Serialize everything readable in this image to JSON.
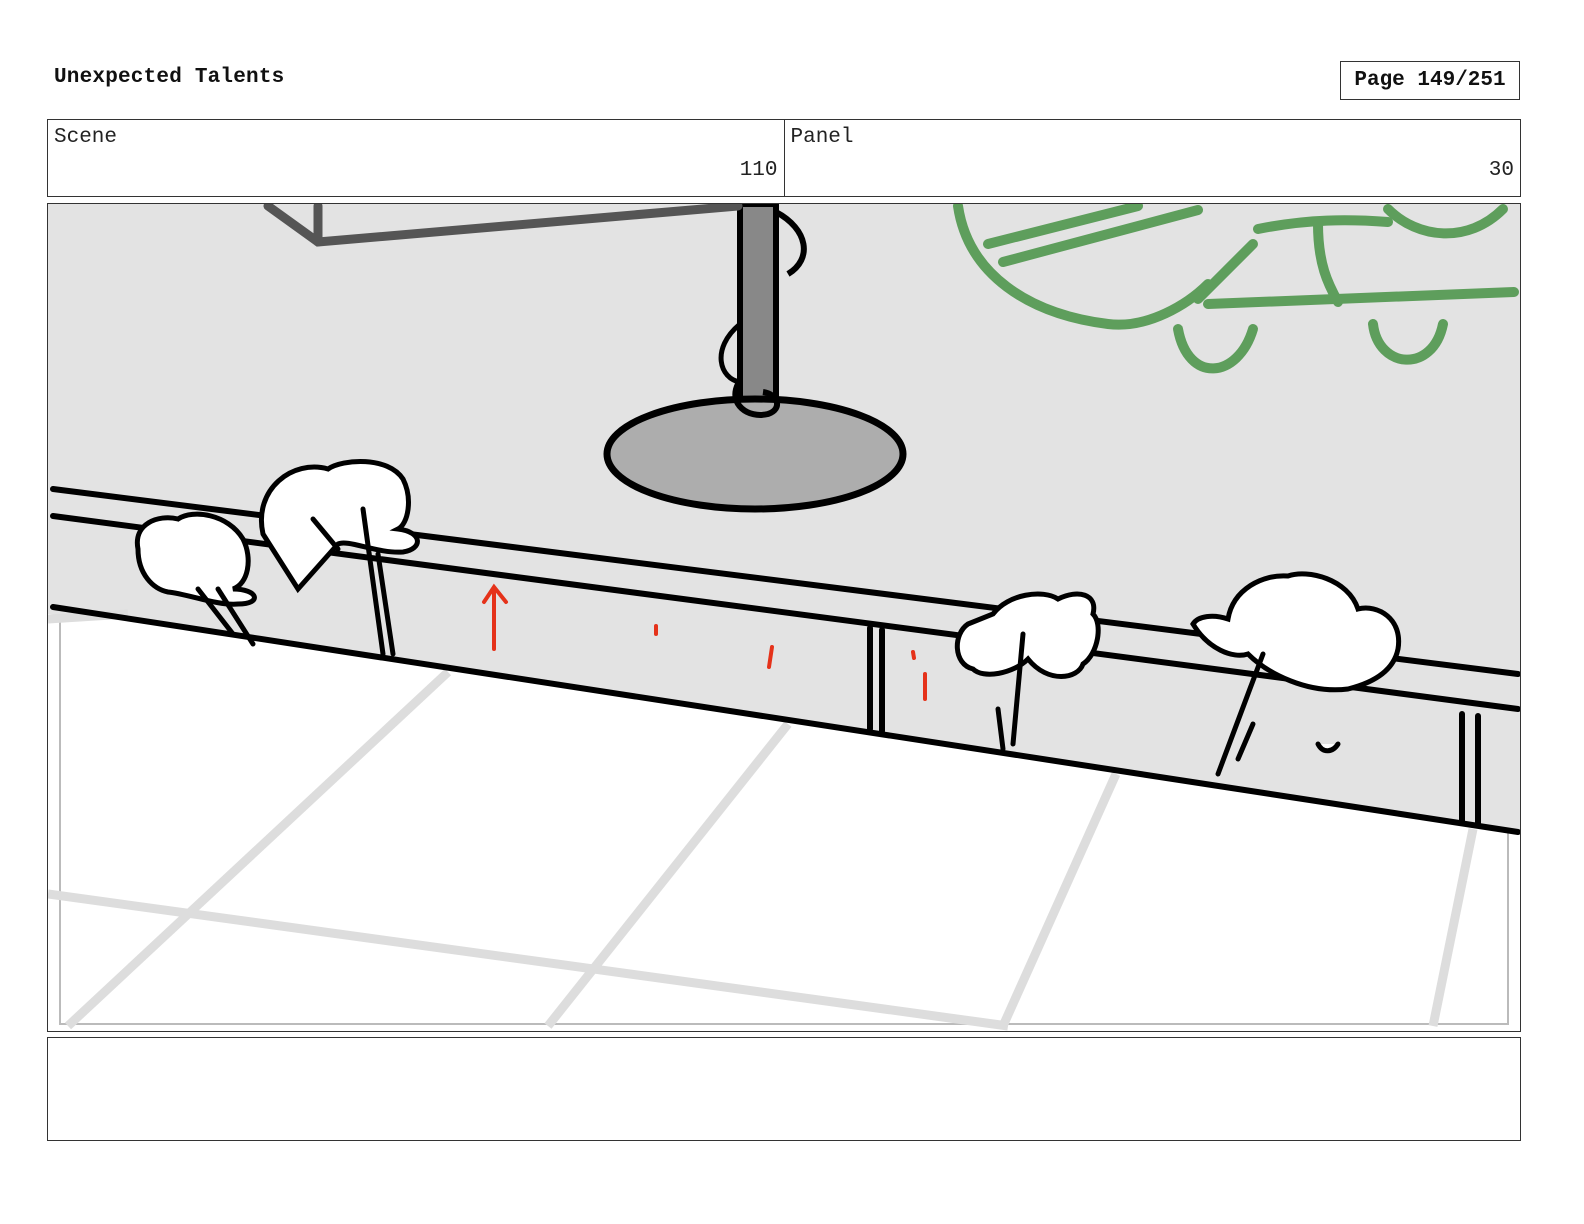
{
  "header": {
    "title": "Unexpected Talents",
    "page_label": "Page 149/251"
  },
  "info": {
    "scene_label": "Scene",
    "scene_value": "110",
    "panel_label": "Panel",
    "panel_value": "30"
  },
  "panel": {
    "colors": {
      "floor_shadow": "#e3e3e3",
      "ink": "#000000",
      "plant": "#5e9e5c",
      "stand_base": "#adadad",
      "pole": "#888888",
      "grid_lines": "#dddddd",
      "action_marks": "#e5321a"
    }
  },
  "notes": {
    "text": ""
  }
}
